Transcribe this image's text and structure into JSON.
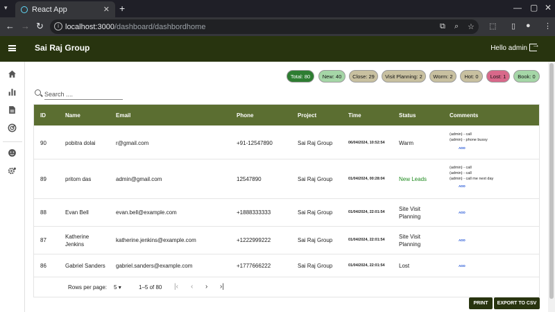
{
  "browser": {
    "tab_title": "React App",
    "url_host": "localhost:3000",
    "url_path": "/dashboard/dashbordhome"
  },
  "header": {
    "brand": "Sai Raj Group",
    "greeting": "Hello admin"
  },
  "chips": [
    {
      "label": "Total: 80",
      "bg": "#2e7d32",
      "fg": "#ffffff"
    },
    {
      "label": "New: 40",
      "bg": "#a5d6a7",
      "fg": "#111111"
    },
    {
      "label": "Close: 29",
      "bg": "#c8c0a0",
      "fg": "#111111"
    },
    {
      "label": "Visit Planning: 2",
      "bg": "#c8c0a0",
      "fg": "#111111"
    },
    {
      "label": "Worm: 2",
      "bg": "#c8c0a0",
      "fg": "#111111"
    },
    {
      "label": "Hot: 0",
      "bg": "#c8c0a0",
      "fg": "#111111"
    },
    {
      "label": "Lost: 1",
      "bg": "#d8688a",
      "fg": "#111111"
    },
    {
      "label": "Book: 0",
      "bg": "#a5d6a7",
      "fg": "#111111"
    }
  ],
  "search": {
    "placeholder": "Search ...."
  },
  "table": {
    "headers": [
      "ID",
      "Name",
      "Email",
      "Phone",
      "Project",
      "Time",
      "Status",
      "Comments"
    ],
    "rows": [
      {
        "id": "90",
        "name": "pobitra dolai",
        "email": "r@gmail.com",
        "phone": "+91-12547890",
        "project": "Sai Raj Group",
        "time": "06/04/2024, 10:52:54",
        "status": "Warm",
        "comments": [
          "(admin) - call",
          "(admin) - phone bussy"
        ],
        "add": "ADD"
      },
      {
        "id": "89",
        "name": "pritom das",
        "email": "admin@gmail.com",
        "phone": "12547890",
        "project": "Sai Raj Group",
        "time": "01/04/2024, 00:28:04",
        "status": "New Leads",
        "comments": [
          "(admin) - call",
          "(admin) - call",
          "(admin) - call me next day"
        ],
        "add": "ADD"
      },
      {
        "id": "88",
        "name": "Evan Bell",
        "email": "evan.bell@example.com",
        "phone": "+1888333333",
        "project": "Sai Raj Group",
        "time": "01/04/2024, 22:01:54",
        "status": "Site Visit Planning",
        "comments": [],
        "add": "ADD"
      },
      {
        "id": "87",
        "name": "Katherine Jenkins",
        "email": "katherine.jenkins@example.com",
        "phone": "+1222999222",
        "project": "Sai Raj Group",
        "time": "01/04/2024, 22:01:54",
        "status": "Site Visit Planning",
        "comments": [],
        "add": "ADD"
      },
      {
        "id": "86",
        "name": "Gabriel Sanders",
        "email": "gabriel.sanders@example.com",
        "phone": "+1777666222",
        "project": "Sai Raj Group",
        "time": "01/04/2024, 22:01:54",
        "status": "Lost",
        "comments": [],
        "add": "ADD"
      }
    ]
  },
  "pagination": {
    "rows_per_page_label": "Rows per page:",
    "rows_per_page": "5",
    "range": "1–5 of 80"
  },
  "actions": {
    "print": "PRINT",
    "export": "EXPORT TO CSV"
  }
}
